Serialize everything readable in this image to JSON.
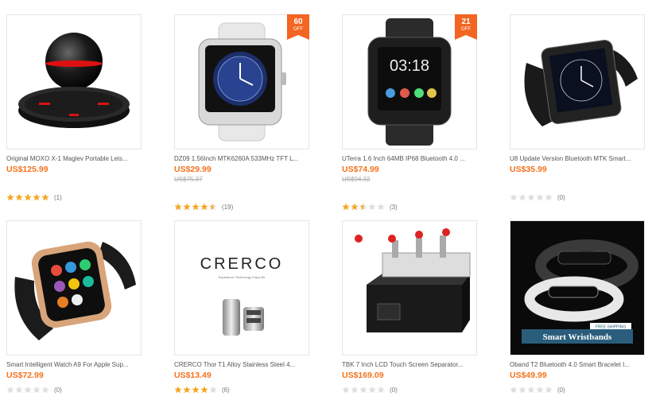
{
  "products": [
    {
      "title": "Original MOXO X-1 Maglev Portable Leis...",
      "price": "US$125.99",
      "old_price": "",
      "rating": 5,
      "reviews": "(1)",
      "badge": "",
      "badge_off": "",
      "image": "maglev-speaker"
    },
    {
      "title": "DZ09 1.56Inch MTK6260A 533MHz TFT L...",
      "price": "US$29.99",
      "old_price": "US$75.37",
      "rating": 4.5,
      "reviews": "(19)",
      "badge": "60",
      "badge_off": "OFF",
      "image": "white-smartwatch"
    },
    {
      "title": "UTerra 1.6 Inch 64MB IP68 Bluetooth 4.0 ...",
      "price": "US$74.99",
      "old_price": "US$94.32",
      "rating": 2.5,
      "reviews": "(3)",
      "badge": "21",
      "badge_off": "OFF",
      "image": "rugged-smartwatch"
    },
    {
      "title": "U8 Update Version Bluetooth MTK Smart...",
      "price": "US$35.99",
      "old_price": "",
      "rating": 0,
      "reviews": "(0)",
      "badge": "",
      "badge_off": "",
      "image": "black-smartwatch"
    },
    {
      "title": "Smart Intelligent Watch A9 For Apple Sup...",
      "price": "US$72.99",
      "old_price": "",
      "rating": 0,
      "reviews": "(0)",
      "badge": "",
      "badge_off": "",
      "image": "gold-smartwatch"
    },
    {
      "title": "CRERCO Thor T1 Alloy Stainless Steel 4...",
      "price": "US$13.49",
      "old_price": "",
      "rating": 4,
      "reviews": "(6)",
      "badge": "",
      "badge_off": "",
      "image": "car-charger",
      "brand": "CRERCO",
      "tagline": "Experience Technology Enjoy life"
    },
    {
      "title": "TBK 7 Inch LCD Touch Screen Separator...",
      "price": "US$169.09",
      "old_price": "",
      "rating": 0,
      "reviews": "(0)",
      "badge": "",
      "badge_off": "",
      "image": "lcd-separator"
    },
    {
      "title": "Oband T2 Bluetooth 4.0 Smart Bracelet I...",
      "price": "US$49.99",
      "old_price": "",
      "rating": 0,
      "reviews": "(0)",
      "badge": "",
      "badge_off": "",
      "image": "smart-bracelet",
      "banner": "Smart Wristbands",
      "sub_banner": "FREE SHIPPING"
    }
  ],
  "colors": {
    "price": "#f5721c",
    "star_on": "#f5a623",
    "star_off": "#dddddd",
    "badge": "#f26522"
  }
}
